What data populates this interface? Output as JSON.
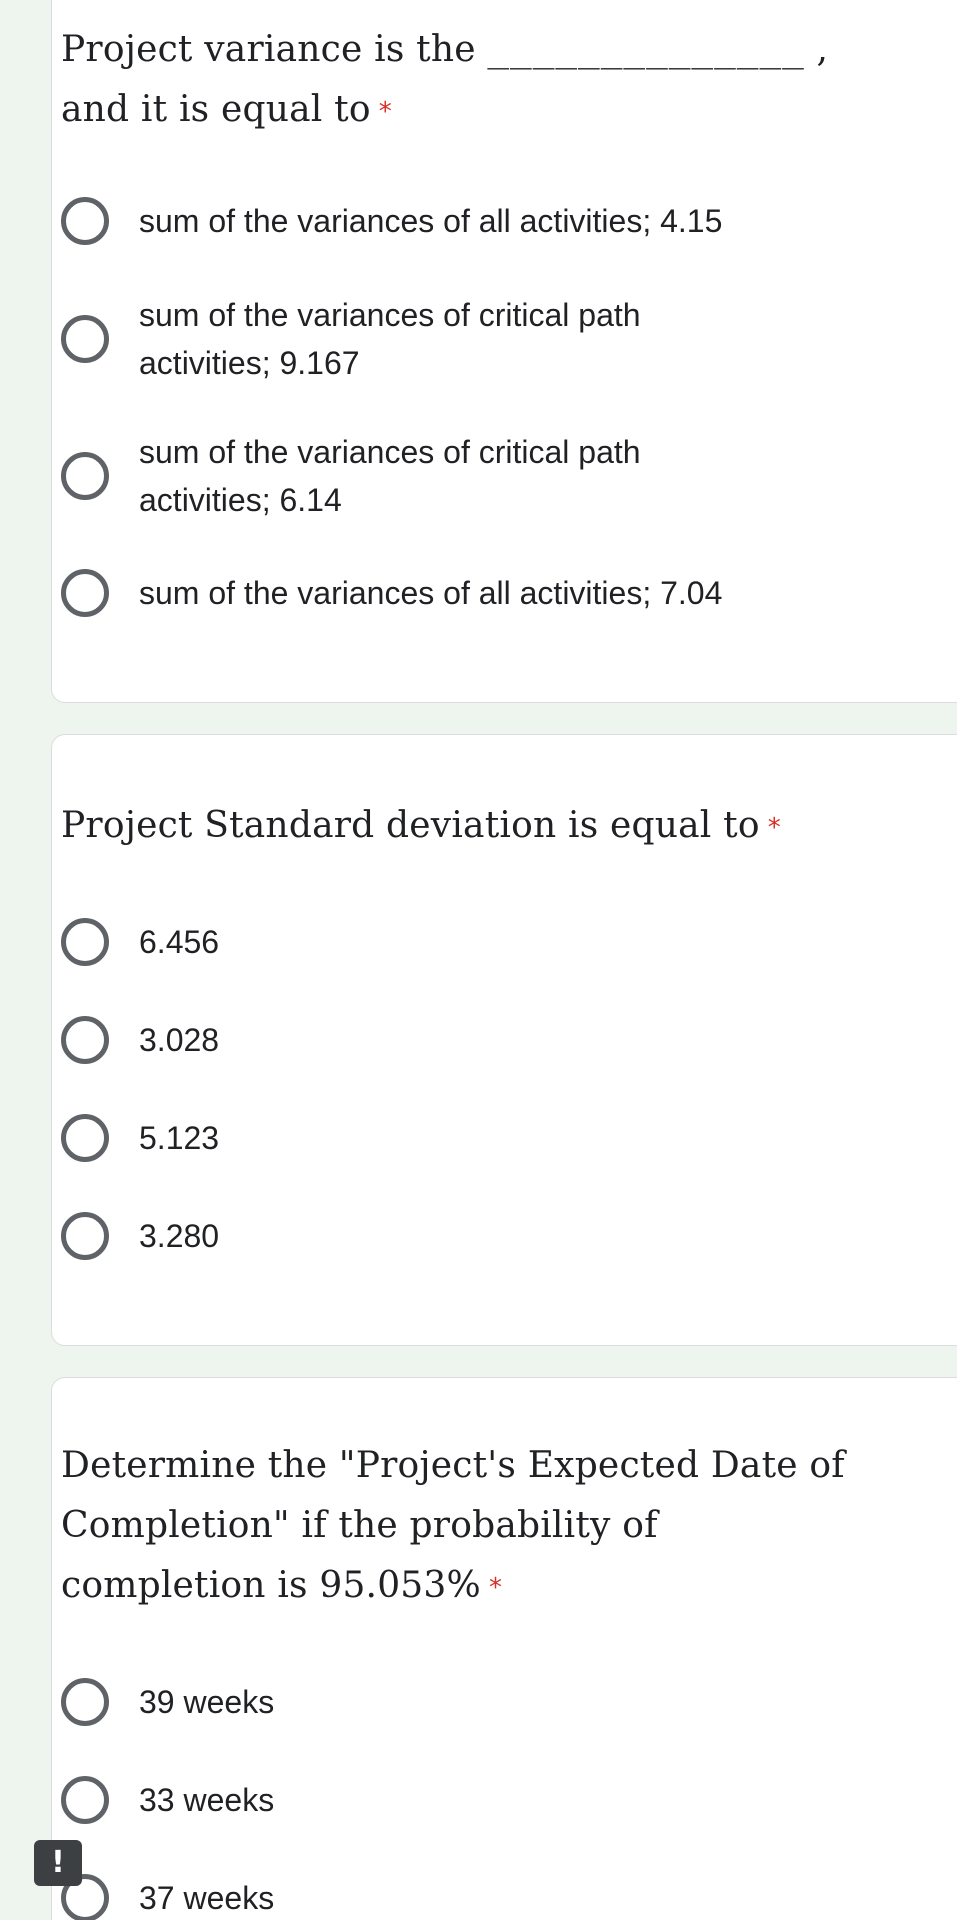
{
  "questions": [
    {
      "text_before": "Project variance is the ",
      "blank": "______________",
      "text_after": " , and it is equal to",
      "required_mark": "*",
      "options": [
        "sum of the variances of all activities; 4.15",
        "sum of the variances of critical path activities; 9.167",
        "sum of the variances of critical path activities; 6.14",
        "sum of the variances of all activities; 7.04"
      ]
    },
    {
      "text": "Project Standard deviation is equal to",
      "required_mark": "*",
      "options": [
        "6.456",
        "3.028",
        "5.123",
        "3.280"
      ]
    },
    {
      "text": "Determine the \"Project's Expected Date of Completion\" if the probability of completion is 95.053%",
      "required_mark": "*",
      "options": [
        "39 weeks",
        "33 weeks",
        "37 weeks"
      ]
    }
  ],
  "feedback_button": "!",
  "colors": {
    "background": "#eef5ef",
    "card": "#ffffff",
    "required": "#d93025",
    "radio_border": "#5f6368",
    "text": "#202124"
  }
}
